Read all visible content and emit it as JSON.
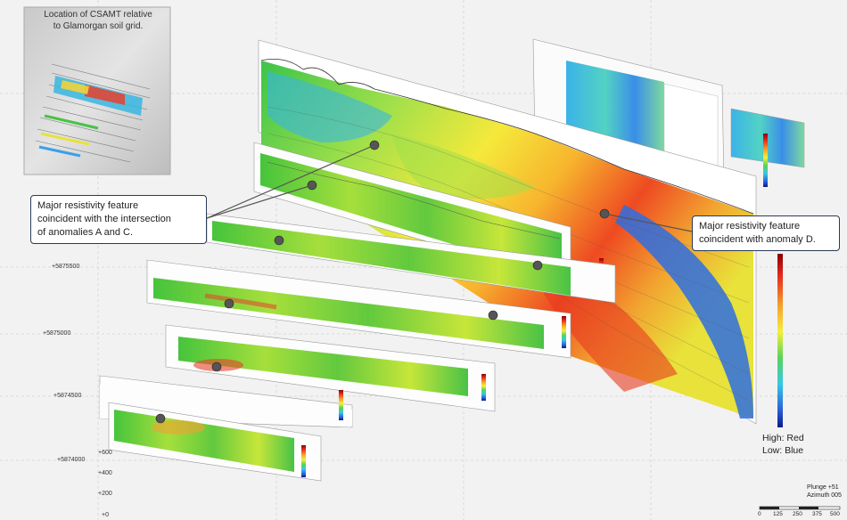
{
  "inset": {
    "title_line1": "Location of CSAMT relative",
    "title_line2": "to Glamorgan soil grid."
  },
  "callouts": [
    {
      "line1": "Major resistivity feature",
      "line2": "coincident with the intersection",
      "line3": "of anomalies A and C."
    },
    {
      "line1": "Major resistivity feature",
      "line2": "coincident with anomaly D."
    }
  ],
  "legend": {
    "high": "High: Red",
    "low": "Low: Blue"
  },
  "northings": [
    "+5875500",
    "+5875000",
    "+5874500",
    "+5874000"
  ],
  "elevations": [
    "+600",
    "+400",
    "+200",
    "+0"
  ],
  "view": {
    "plunge": "Plunge +51",
    "azimuth": "Azimuth 005"
  },
  "scale": {
    "ticks": [
      "0",
      "125",
      "250",
      "375",
      "500"
    ]
  },
  "colors": {
    "high": "#d7191c",
    "mid": "#ffff40",
    "low": "#2b5fd9",
    "callout_border": "#2b3a55"
  }
}
